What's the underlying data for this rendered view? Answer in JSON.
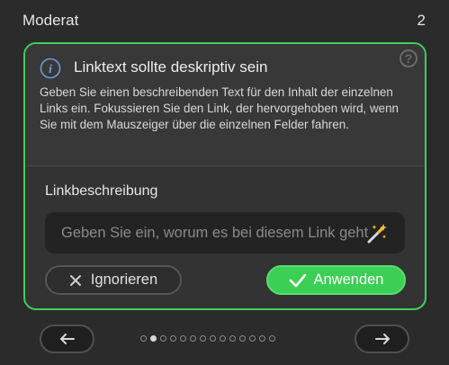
{
  "header": {
    "severity": "Moderat",
    "count": "2"
  },
  "card": {
    "title": "Linktext sollte deskriptiv sein",
    "description": "Geben Sie einen beschreibenden Text für den Inhalt der einzelnen Links ein. Fokussieren Sie den Link, der hervorgehoben wird, wenn Sie mit dem Mauszeiger über die einzelnen Felder fahren.",
    "help_symbol": "?",
    "field_label": "Linkbeschreibung",
    "input_placeholder": "Geben Sie ein, worum es bei diesem Link geht",
    "input_value": "",
    "ignore_label": "Ignorieren",
    "apply_label": "Anwenden"
  },
  "pagination": {
    "total": 14,
    "current": 2
  },
  "colors": {
    "accent": "#3fcf5a",
    "background": "#2b2b2b",
    "card": "#333333"
  },
  "icons": [
    "info-icon",
    "help-icon",
    "magic-wand-icon",
    "close-icon",
    "checkmark-icon",
    "arrow-left-icon",
    "arrow-right-icon"
  ]
}
